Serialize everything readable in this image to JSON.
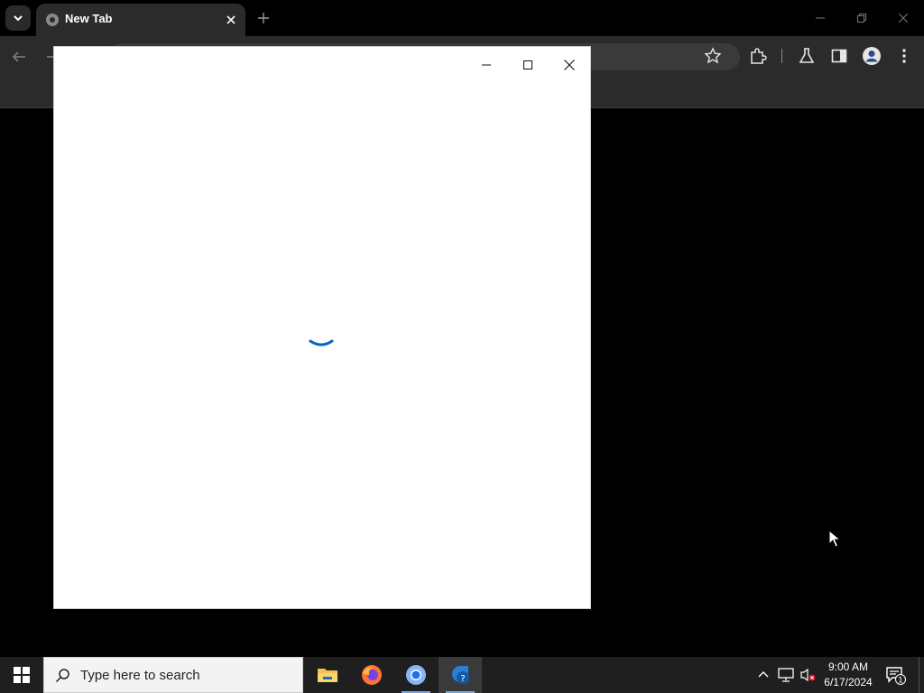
{
  "browser": {
    "tab": {
      "title": "New Tab"
    },
    "colors": {
      "frame": "#000000",
      "toolbar": "#2b2b2b",
      "tab_active": "#2b2b2b"
    }
  },
  "dialog": {
    "state": "loading",
    "spinner_color": "#0067c0",
    "background": "#ffffff"
  },
  "taskbar": {
    "search_placeholder": "Type here to search",
    "apps": [
      "file-explorer-icon",
      "firefox-icon",
      "chrome-icon",
      "get-help-icon"
    ],
    "clock": {
      "time": "9:00 AM",
      "date": "6/17/2024"
    },
    "notification_count": "1"
  }
}
